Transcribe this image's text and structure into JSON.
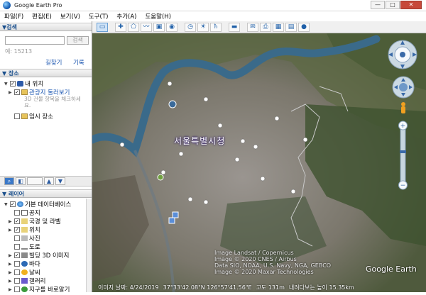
{
  "window": {
    "title": "Google Earth Pro",
    "minimize": "—",
    "maximize": "□",
    "close": "✕"
  },
  "menu": [
    "파일(F)",
    "편집(E)",
    "보기(V)",
    "도구(T)",
    "추가(A)",
    "도움말(H)"
  ],
  "search": {
    "header": "▼검색",
    "placeholder": "",
    "button": "검색",
    "hint": "예: 15213",
    "link_directions": "길찾기",
    "link_history": "기록"
  },
  "places": {
    "header": "▼ 장소",
    "items": [
      {
        "label": "내 위치"
      },
      {
        "label": "관광지 둘러보기"
      },
      {
        "label": "3D 건물 항목을 체크하세요."
      },
      {
        "label": "임시 장소"
      }
    ]
  },
  "layers": {
    "header": "▼ 레이어",
    "items": [
      {
        "label": "기본 데이터베이스"
      },
      {
        "label": "공지"
      },
      {
        "label": "국경 및 라벨"
      },
      {
        "label": "위치"
      },
      {
        "label": "사진"
      },
      {
        "label": "도로"
      },
      {
        "label": "빌딩 3D 이미지"
      },
      {
        "label": "바다"
      },
      {
        "label": "날씨"
      },
      {
        "label": "갤러리"
      },
      {
        "label": "지구를 바로알기"
      }
    ]
  },
  "map": {
    "city_label": "서울특별시청",
    "credits": [
      "Image Landsat / Copernicus",
      "Image © 2020 CNES / Airbus",
      "Data SIO, NOAA, U.S. Navy, NGA, GEBCO",
      "Image © 2020 Maxar Technologies"
    ],
    "logo": "Google Earth",
    "status": {
      "image_date": "이미지 날짜: 4/24/2019",
      "coords": "37°33'42.08\"N  126°57'41.56\"E",
      "elevation": "고도  131m",
      "eye_alt": "내려다보는 높이  15.35km"
    }
  },
  "colors": {
    "accent": "#1a55b0",
    "header_text": "#1a4f8c",
    "river": "#3a6a8a"
  }
}
